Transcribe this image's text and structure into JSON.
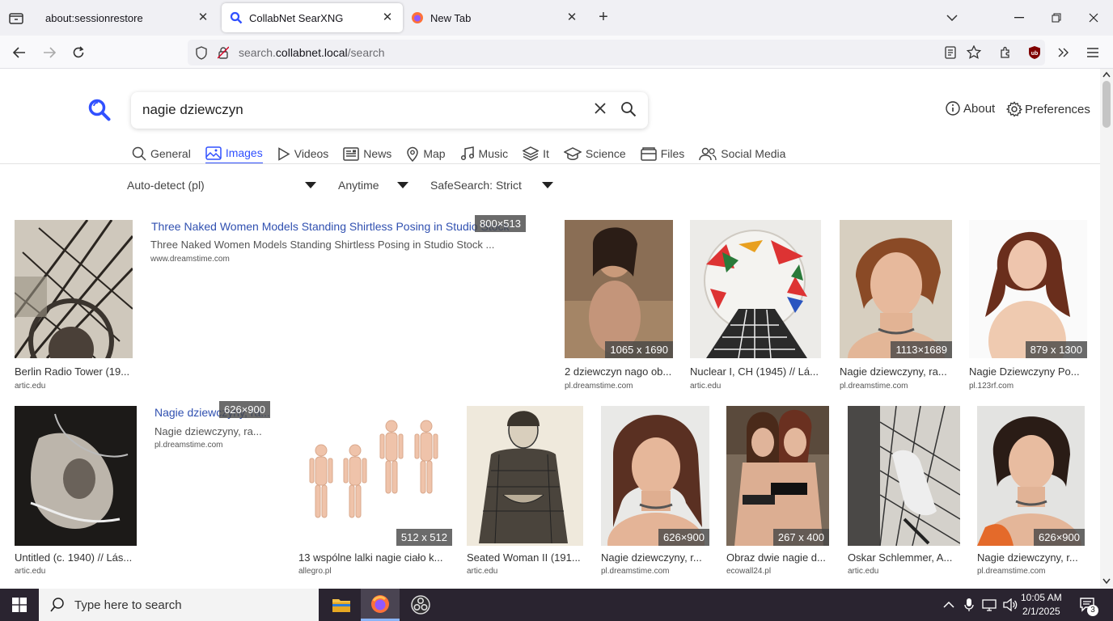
{
  "browser": {
    "tabs": [
      {
        "title": "about:sessionrestore"
      },
      {
        "title": "CollabNet SearXNG"
      },
      {
        "title": "New Tab"
      }
    ],
    "url_prefix": "search.",
    "url_domain": "collabnet.local",
    "url_path": "/search"
  },
  "search": {
    "query": "nagie dziewczyn",
    "about_label": "About",
    "preferences_label": "Preferences"
  },
  "categories": [
    {
      "label": "General",
      "icon": "search-icon"
    },
    {
      "label": "Images",
      "icon": "image-icon"
    },
    {
      "label": "Videos",
      "icon": "play-icon"
    },
    {
      "label": "News",
      "icon": "newspaper-icon"
    },
    {
      "label": "Map",
      "icon": "map-pin-icon"
    },
    {
      "label": "Music",
      "icon": "music-icon"
    },
    {
      "label": "It",
      "icon": "layers-icon"
    },
    {
      "label": "Science",
      "icon": "school-icon"
    },
    {
      "label": "Files",
      "icon": "folder-icon"
    },
    {
      "label": "Social Media",
      "icon": "people-icon"
    }
  ],
  "filters": {
    "language": "Auto-detect (pl)",
    "time": "Anytime",
    "safesearch": "SafeSearch: Strict"
  },
  "results": [
    {
      "caption": "Berlin Radio Tower (19...",
      "source": "artic.edu"
    },
    {
      "link": "Three Naked Women Models Standing Shirtless Posing in Studio Stock",
      "desc": "Three Naked Women Models Standing Shirtless Posing in Studio Stock ...",
      "source": "www.dreamstime.com",
      "size": "800×513"
    },
    {
      "caption": "2 dziewczyn nago ob...",
      "source": "pl.dreamstime.com",
      "size": "1065 x 1690"
    },
    {
      "caption": "Nuclear I, CH (1945) // Lá...",
      "source": "artic.edu"
    },
    {
      "caption": "Nagie dziewczyny, ra...",
      "source": "pl.dreamstime.com",
      "size": "1113×1689"
    },
    {
      "caption": "Nagie Dziewczyny Po...",
      "source": "pl.123rf.com",
      "size": "879 x 1300"
    },
    {
      "caption": "Untitled (c. 1940) // Lás...",
      "source": "artic.edu"
    },
    {
      "link": "Nagie dziewczyny, ra...",
      "desc": "Nagie dziewczyny, ra...",
      "source": "pl.dreamstime.com",
      "size": "626×900"
    },
    {
      "caption": "13 wspólne lalki nagie ciało k...",
      "source": "allegro.pl",
      "size": "512 x 512"
    },
    {
      "caption": "Seated Woman II (191...",
      "source": "artic.edu"
    },
    {
      "caption": "Nagie dziewczyny, r...",
      "source": "pl.dreamstime.com",
      "size": "626×900"
    },
    {
      "caption": "Obraz dwie nagie d...",
      "source": "ecowall24.pl",
      "size": "267 x 400"
    },
    {
      "caption": "Oskar Schlemmer, A...",
      "source": "artic.edu"
    },
    {
      "caption": "Nagie dziewczyny, r...",
      "source": "pl.dreamstime.com",
      "size": "626×900"
    }
  ],
  "taskbar": {
    "search_placeholder": "Type here to search",
    "time": "10:05 AM",
    "date": "2/1/2025",
    "notification_count": "3"
  }
}
